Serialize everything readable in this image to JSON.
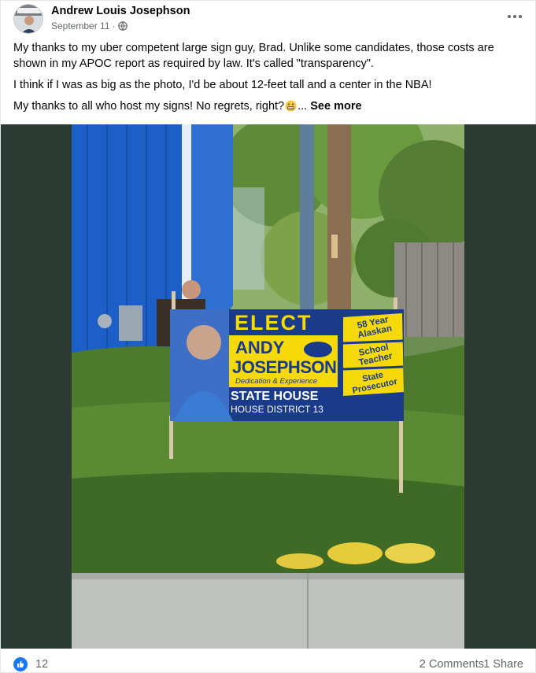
{
  "post": {
    "author": "Andrew Louis Josephson",
    "date": "September 11",
    "separator": "·",
    "paragraphs": [
      "My thanks to my uber competent large sign guy, Brad.  Unlike some candidates, those costs are shown in my APOC report as required by law.  It's called \"transparency\".",
      "I think if I was as big as the photo, I'd be about 12-feet tall and a center in the NBA!"
    ],
    "last_line": "My thanks to all who host my signs!  No regrets, right?",
    "ellipsis": "...",
    "see_more": "See more"
  },
  "sign": {
    "elect": "ELECT",
    "first_name": "ANDY",
    "last_name": "JOSEPHSON",
    "tagline": "Dedication & Experience",
    "office": "STATE HOUSE",
    "district": "HOUSE DISTRICT 13",
    "badge_1": "58 Year Alaskan",
    "badge_2": "School Teacher",
    "badge_3": "State Prosecutor"
  },
  "footer": {
    "likes": "12",
    "comments": "2 Comments",
    "shares": "1 Share"
  },
  "colors": {
    "facebook_blue": "#1877f2",
    "sign_blue": "#1a3a8a",
    "sign_yellow": "#f5d90a"
  }
}
